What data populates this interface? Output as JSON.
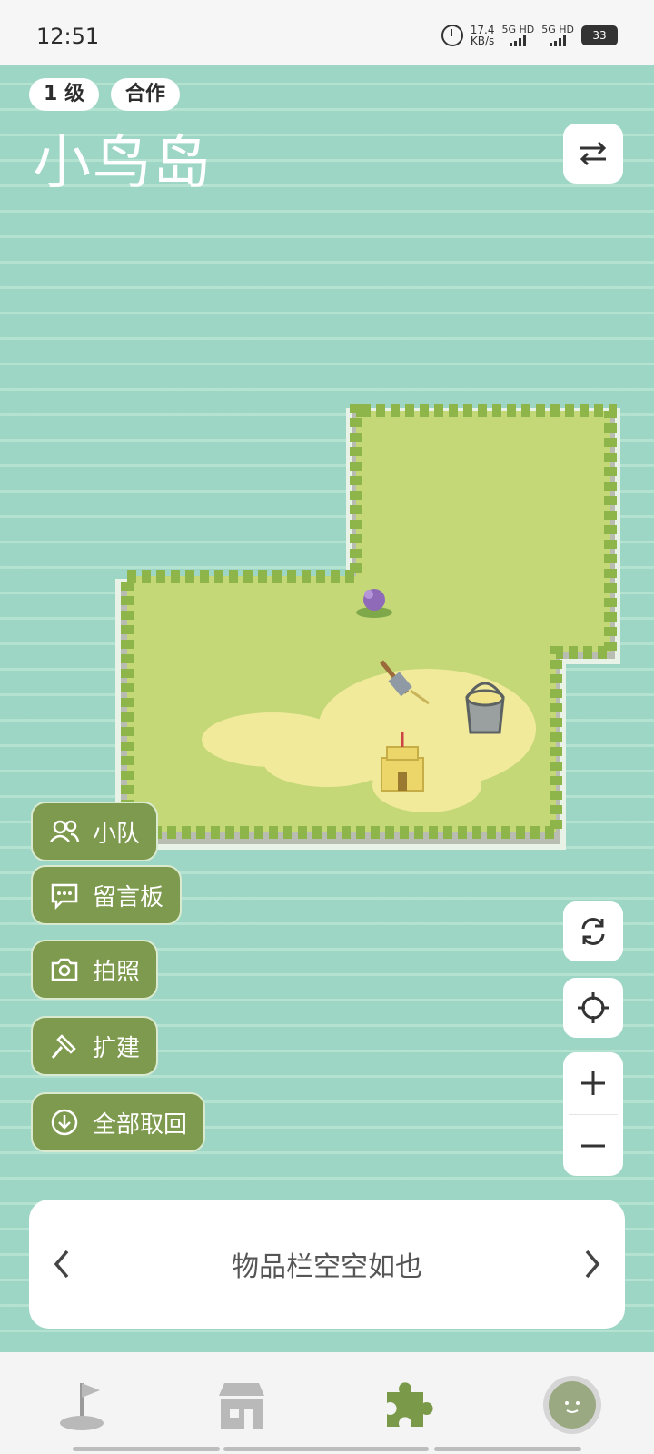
{
  "status_bar": {
    "time": "12:51",
    "net_speed_value": "17.4",
    "net_speed_unit": "KB/s",
    "sim1": "5G HD",
    "sim2": "5G HD",
    "battery": "33"
  },
  "header": {
    "level_badge": "1 级",
    "mode_badge": "合作",
    "island_name": "小鸟岛"
  },
  "side_menu": {
    "items": [
      {
        "label": "小队",
        "icon": "team-icon"
      },
      {
        "label": "留言板",
        "icon": "message-board-icon"
      },
      {
        "label": "拍照",
        "icon": "camera-icon"
      },
      {
        "label": "扩建",
        "icon": "hammer-icon"
      },
      {
        "label": "全部取回",
        "icon": "retrieve-all-icon"
      }
    ]
  },
  "inventory": {
    "empty_text": "物品栏空空如也"
  },
  "bottom_nav": {
    "items": [
      "flag-icon",
      "shop-icon",
      "puzzle-icon",
      "avatar"
    ],
    "active_index": 2
  },
  "colors": {
    "water": "#9dd6c4",
    "grass": "#c4d877",
    "sand": "#f2ea9b",
    "button_green": "#7e9a4e",
    "active_nav": "#7a9a4a"
  }
}
